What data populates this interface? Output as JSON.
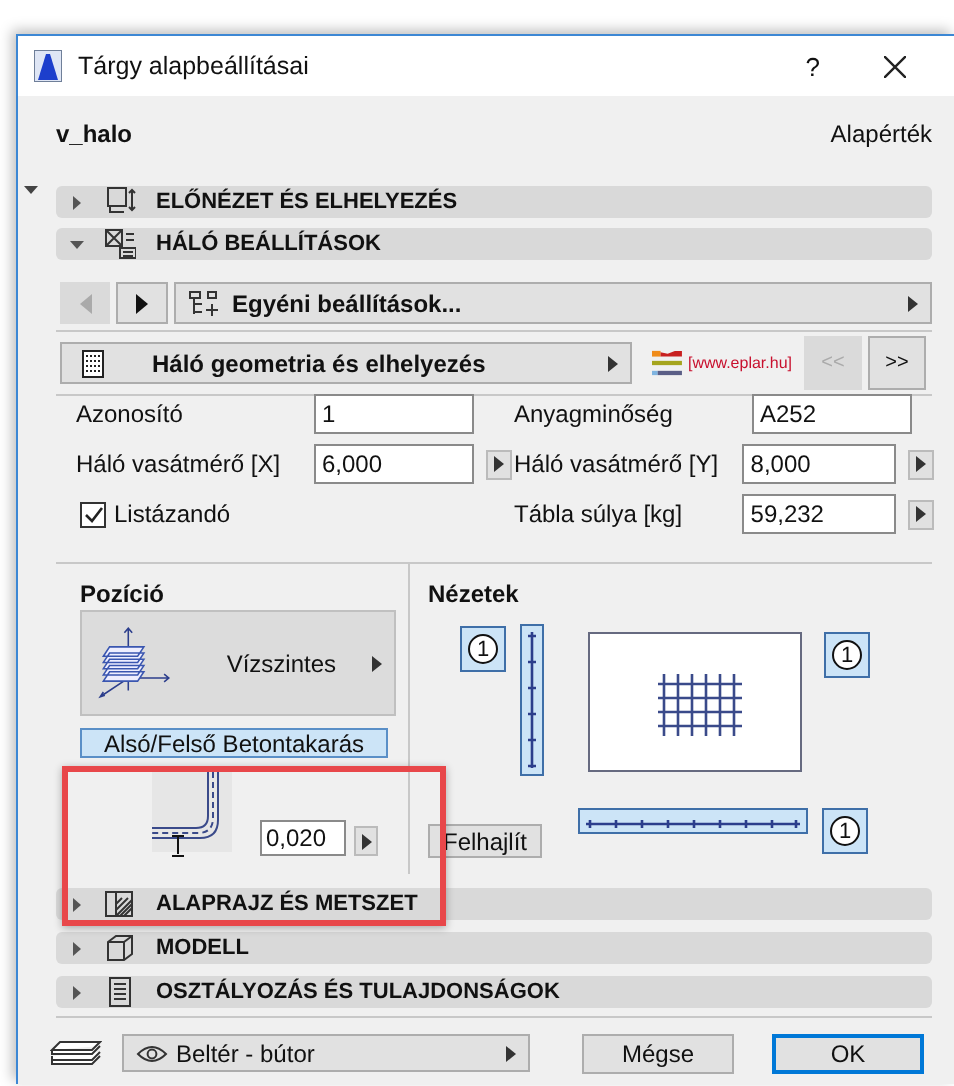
{
  "window": {
    "title": "Tárgy alapbeállításai",
    "help": "?"
  },
  "object_name": "v_halo",
  "default_label": "Alapérték",
  "sections": [
    {
      "label": "ELŐNÉZET ÉS ELHELYEZÉS",
      "expanded": false
    },
    {
      "label": "HÁLÓ BEÁLLÍTÁSOK",
      "expanded": true
    },
    {
      "label": "ALAPRAJZ ÉS METSZET",
      "expanded": false
    },
    {
      "label": "MODELL",
      "expanded": false
    },
    {
      "label": "OSZTÁLYOZÁS ÉS TULAJDONSÁGOK",
      "expanded": false
    }
  ],
  "preset_nav": {
    "prev_disabled": true,
    "next_disabled": false,
    "preset": "Egyéni beállítások..."
  },
  "page_selector": {
    "page": "Háló geometria és elhelyezés",
    "logo_text": "[www.eplar.hu]",
    "buttons": [
      {
        "label": "<<",
        "disabled": true
      },
      {
        "label": ">>",
        "disabled": false
      }
    ]
  },
  "parameters": [
    {
      "kind": "text",
      "label": "Azonosító",
      "value": "1"
    },
    {
      "kind": "text",
      "label": "Anyagminőség",
      "value": "A252"
    },
    {
      "kind": "stepper",
      "label": "Háló vasátmérő [X]",
      "value": "6,000"
    },
    {
      "kind": "stepper",
      "label": "Háló vasátmérő [Y]",
      "value": "8,000"
    },
    {
      "kind": "checkbox",
      "label": "Listázandó",
      "checked": true
    },
    {
      "kind": "stepper",
      "label": "Tábla súlya [kg]",
      "value": "59,232"
    }
  ],
  "position": {
    "title": "Pozíció",
    "option": "Vízszintes",
    "cover_button": "Alsó/Felső Betontakarás",
    "cover_value": "0,020"
  },
  "views": {
    "title": "Nézetek",
    "badges": [
      "1",
      "1",
      "1"
    ],
    "bend_button": "Felhajlít"
  },
  "footer": {
    "layer": "Beltér - bútor",
    "cancel": "Mégse",
    "ok": "OK"
  }
}
